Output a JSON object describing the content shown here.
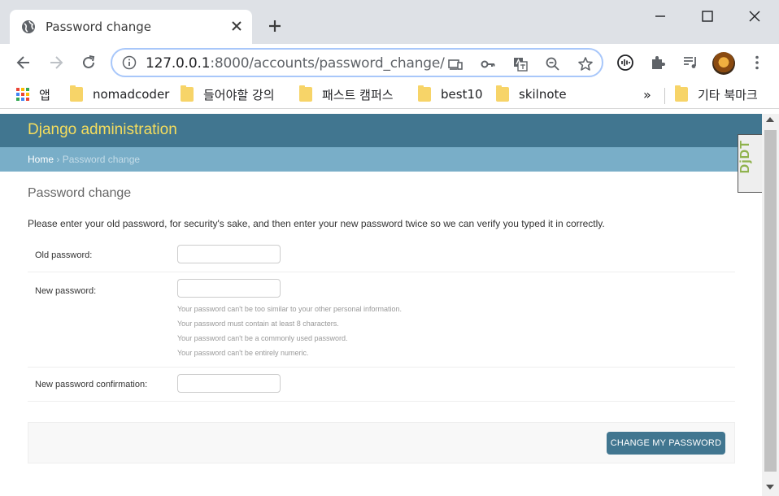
{
  "browser": {
    "tab_title": "Password change",
    "url_host": "127.0.0.1",
    "url_rest": ":8000/accounts/password_change/",
    "bookmarks": {
      "apps_label": "앱",
      "items": [
        "nomadcoder",
        "들어야할 강의",
        "패스트 캠퍼스",
        "best10",
        "skilnote"
      ],
      "overflow": "»",
      "other": "기타 북마크"
    }
  },
  "django": {
    "brand": "Django administration",
    "breadcrumb_home": "Home",
    "breadcrumb_sep": " › ",
    "breadcrumb_current": "Password change",
    "debug_toolbar": "DjDT",
    "page_title": "Password change",
    "intro": "Please enter your old password, for security's sake, and then enter your new password twice so we can verify you typed it in correctly.",
    "fields": {
      "old_password_label": "Old password:",
      "new_password_label": "New password:",
      "confirm_label": "New password confirmation:"
    },
    "help": [
      "Your password can't be too similar to your other personal information.",
      "Your password must contain at least 8 characters.",
      "Your password can't be a commonly used password.",
      "Your password can't be entirely numeric."
    ],
    "submit_label": "Change my password"
  },
  "colors": {
    "header": "#417690",
    "breadcrumbs": "#79aec8",
    "brand_text": "#f5dd5d"
  }
}
